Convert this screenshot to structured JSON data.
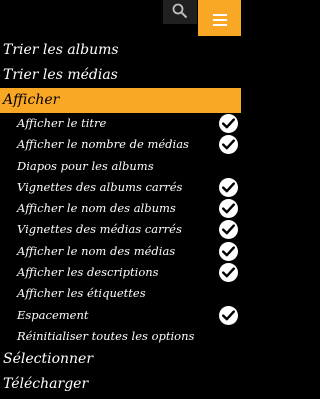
{
  "toolbar": {
    "search_icon": "search-icon",
    "menu_icon": "hamburger-icon",
    "accent": "#f9a825"
  },
  "menu": {
    "sort_albums": "Trier les albums",
    "sort_media": "Trier les médias",
    "display": "Afficher",
    "display_options": [
      {
        "label": "Afficher le titre",
        "checked": true
      },
      {
        "label": "Afficher le nombre de médias",
        "checked": true
      },
      {
        "label": "Diapos pour les albums",
        "checked": false
      },
      {
        "label": "Vignettes des albums carrés",
        "checked": true
      },
      {
        "label": "Afficher le nom des albums",
        "checked": true
      },
      {
        "label": "Vignettes des médias carrés",
        "checked": true
      },
      {
        "label": "Afficher le nom des médias",
        "checked": true
      },
      {
        "label": "Afficher les descriptions",
        "checked": true
      },
      {
        "label": "Afficher les étiquettes",
        "checked": false
      },
      {
        "label": "Espacement",
        "checked": true
      },
      {
        "label": "Réinitialiser toutes les options",
        "checked": false
      }
    ],
    "select": "Sélectionner",
    "download": "Télécharger"
  }
}
